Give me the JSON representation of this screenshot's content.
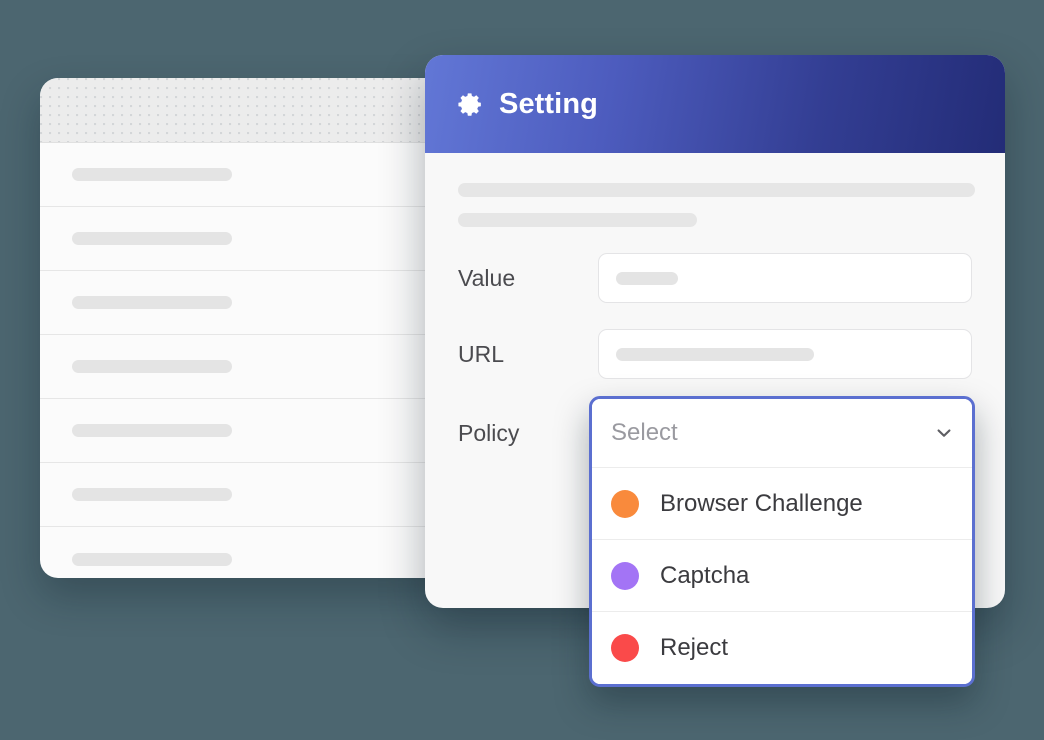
{
  "background_color": "#4c6670",
  "table_card": {
    "name": "data-table-card",
    "header_label": "",
    "rows": [
      {
        "dot_color": "#f98a3c",
        "toggle": "off",
        "skeleton_width": 160
      },
      {
        "dot_color": "#a374f5",
        "toggle": "on",
        "skeleton_width": 160
      },
      {
        "dot_color": "#fa4a4a",
        "toggle": "off",
        "skeleton_width": 160
      },
      {
        "dot_color": "#fa4a4a",
        "toggle": "on",
        "skeleton_width": 160
      },
      {
        "dot_color": "#a374f5",
        "toggle": "off",
        "skeleton_width": 160
      },
      {
        "dot_color": "#f98a3c",
        "toggle": "off",
        "skeleton_width": 160
      },
      {
        "dot_color": "#fa4a4a",
        "toggle": "on",
        "skeleton_width": 160
      }
    ]
  },
  "settings_card": {
    "header": {
      "title": "Setting",
      "icon": "gear-icon",
      "gradient_from": "#6277d6",
      "gradient_to": "#232c77",
      "title_color": "#ffffff"
    },
    "fields": [
      {
        "label": "Value",
        "value": "",
        "placeholder": ""
      },
      {
        "label": "URL",
        "value": "",
        "placeholder": ""
      }
    ],
    "policy": {
      "label": "Policy",
      "placeholder": "Select",
      "selected": "",
      "chevron_icon": "chevron-down-icon",
      "border_color": "#5b6fd0",
      "options": [
        {
          "label": "Browser Challenge",
          "dot_color": "#f98a3c"
        },
        {
          "label": "Captcha",
          "dot_color": "#a374f5"
        },
        {
          "label": "Reject",
          "dot_color": "#fa4a4a"
        }
      ]
    }
  }
}
